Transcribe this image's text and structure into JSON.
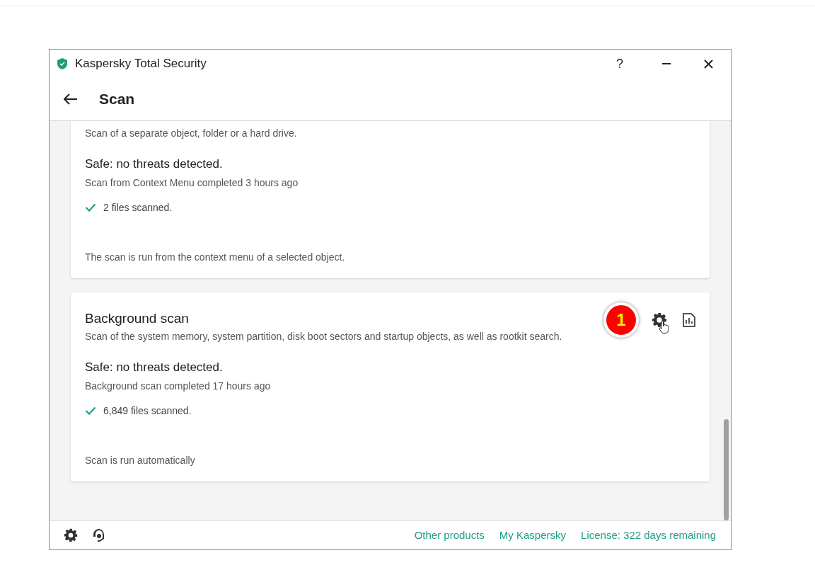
{
  "window": {
    "title": "Kaspersky Total Security",
    "help": "?"
  },
  "header": {
    "title": "Scan"
  },
  "cards": [
    {
      "description": "Scan of a separate object, folder or a hard drive.",
      "status": "Safe: no threats detected.",
      "detail": "Scan from Context Menu completed 3 hours ago",
      "files": "2 files scanned.",
      "footer": "The scan is run from the context menu of a selected object."
    },
    {
      "title": "Background scan",
      "description": "Scan of the system memory, system partition, disk boot sectors and startup objects, as well as rootkit search.",
      "status": "Safe: no threats detected.",
      "detail": "Background scan completed 17 hours ago",
      "files": "6,849 files scanned.",
      "footer": "Scan is run automatically",
      "annotation": "1"
    }
  ],
  "footer": {
    "links": [
      "Other products",
      "My Kaspersky",
      "License: 322 days remaining"
    ]
  }
}
